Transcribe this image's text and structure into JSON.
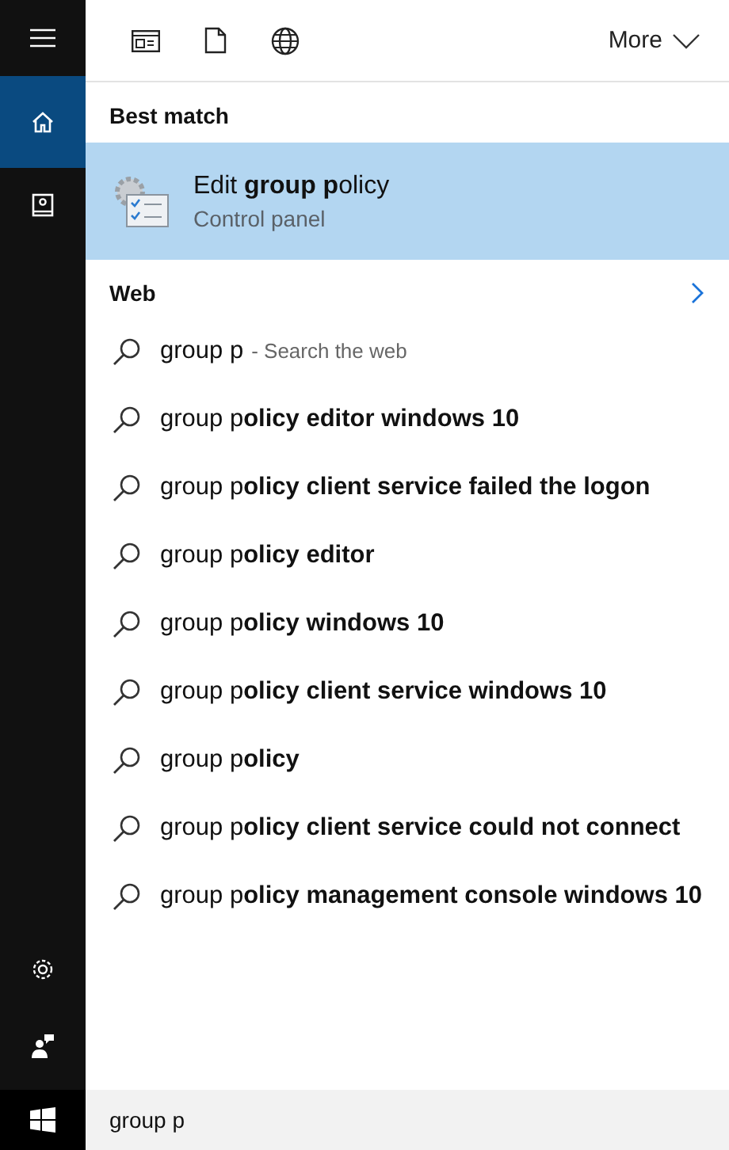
{
  "sidebar": {
    "items": [
      {
        "kind": "home",
        "selected": true
      },
      {
        "kind": "notebook",
        "selected": false
      }
    ],
    "bottom_items": [
      {
        "kind": "settings"
      },
      {
        "kind": "feedback"
      }
    ]
  },
  "toolbar": {
    "filters": [
      {
        "kind": "apps"
      },
      {
        "kind": "document"
      },
      {
        "kind": "web"
      }
    ],
    "more": "More"
  },
  "best_match": {
    "heading": "Best match",
    "title": "Edit **group p**olicy",
    "subtitle": "Control panel",
    "selected": true
  },
  "web": {
    "heading": "Web"
  },
  "suggestions": [
    {
      "kind": "query",
      "text": "group p",
      "hint": "- Search the web"
    },
    {
      "kind": "suggestion",
      "text": "group p**olicy editor windows 10**"
    },
    {
      "kind": "suggestion",
      "text": "group p**olicy client service failed the logon**"
    },
    {
      "kind": "suggestion",
      "text": "group p**olicy editor**"
    },
    {
      "kind": "suggestion",
      "text": "group p**olicy windows 10**"
    },
    {
      "kind": "suggestion",
      "text": "group p**olicy client service windows 10**"
    },
    {
      "kind": "suggestion",
      "text": "group p**olicy**"
    },
    {
      "kind": "suggestion",
      "text": "group p**olicy client service could not connect**"
    },
    {
      "kind": "suggestion",
      "text": "group p**olicy management console windows 10**"
    }
  ],
  "search": {
    "value": "group p"
  }
}
